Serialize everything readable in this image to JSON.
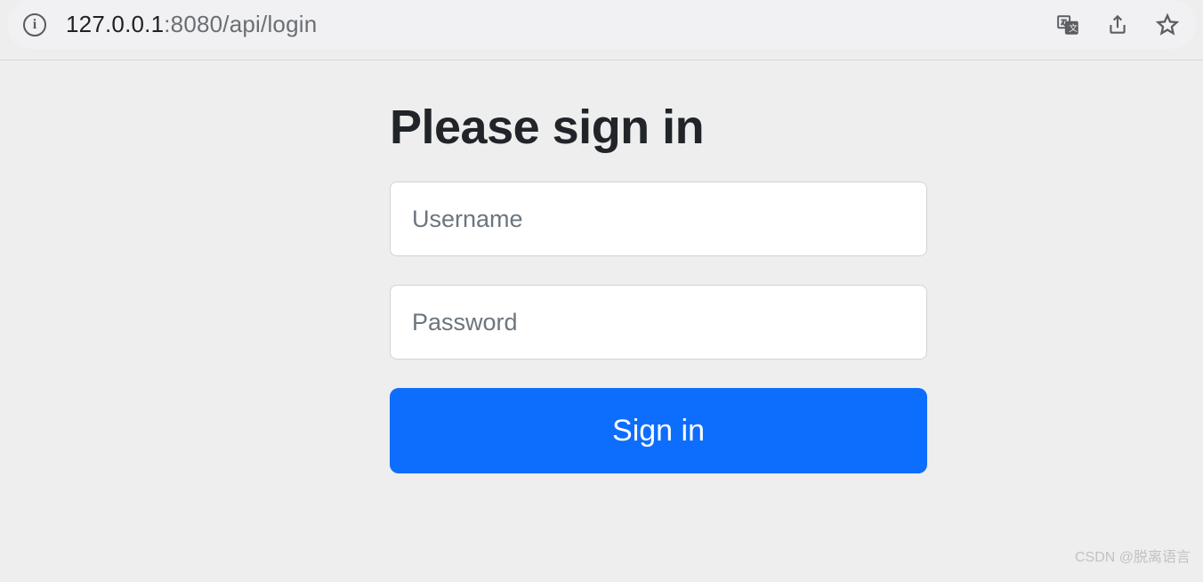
{
  "browser": {
    "url_host": "127.0.0.1",
    "url_path": ":8080/api/login",
    "icons": {
      "info": "info-icon",
      "translate": "translate-icon",
      "share": "share-icon",
      "star": "star-icon"
    }
  },
  "login": {
    "title": "Please sign in",
    "username_placeholder": "Username",
    "username_value": "",
    "password_placeholder": "Password",
    "password_value": "",
    "submit_label": "Sign in"
  },
  "watermark": "CSDN @脱离语言"
}
